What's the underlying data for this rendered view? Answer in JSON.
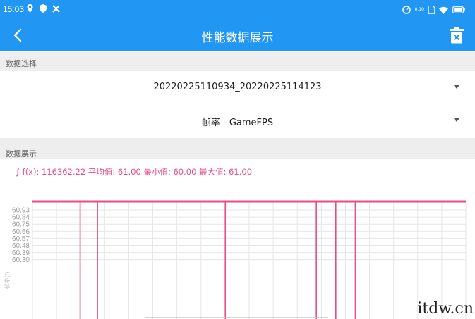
{
  "status_bar": {
    "time": "15:03",
    "left_icons": [
      "location-icon",
      "shield-icon",
      "tools-icon"
    ],
    "right_icons": [
      "speedometer-icon",
      "network-speed-icon",
      "sim-icon",
      "wifi-icon",
      "battery-icon"
    ],
    "network_speed": "0.10"
  },
  "toolbar": {
    "title": "性能数据展示",
    "back_icon": "chevron-left-icon",
    "delete_icon": "trash-icon"
  },
  "data_select": {
    "header": "数据选择",
    "file_value": "20220225110934_20220225114123",
    "metric_value": "帧率 - GameFPS"
  },
  "data_display": {
    "header": "数据展示",
    "stats_line": "∫ f(x): 116362.22 平均值: 61.00 最小值: 60.00 最大值: 61.00"
  },
  "colors": {
    "accent": "#2196f3",
    "series": "#e84d8a",
    "grid": "#e6e6e6",
    "header_bg": "#eeeeee"
  },
  "chart_data": {
    "type": "line",
    "ylabel": "帧率(f)",
    "y_ticks": [
      "60.93",
      "60.84",
      "60.75",
      "60.66",
      "60.57",
      "60.48",
      "60.39",
      "60.30"
    ],
    "series": [
      {
        "baseline": 61.0,
        "dip_value": 60.0,
        "dip_positions": [
          0.11,
          0.15,
          0.445,
          0.655,
          0.7,
          0.745
        ]
      }
    ]
  },
  "watermark": "itdw.cn"
}
